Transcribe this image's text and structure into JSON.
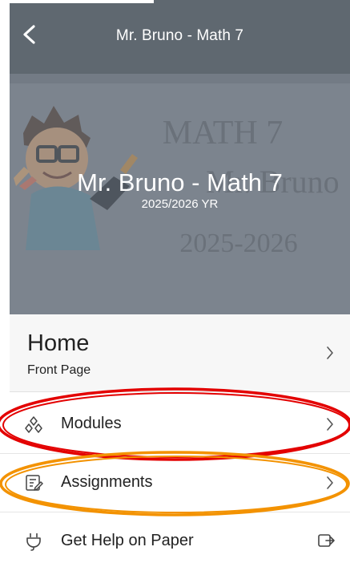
{
  "header": {
    "title": "Mr. Bruno - Math 7",
    "back_icon": "back-icon"
  },
  "hero": {
    "title": "Mr. Bruno - Math 7",
    "subtitle": "2025/2026 YR",
    "art_lines": [
      "MATH 7",
      "Mr. Bruno",
      "2025-2026"
    ]
  },
  "home": {
    "title": "Home",
    "subtitle": "Front Page"
  },
  "menu": {
    "items": [
      {
        "label": "Modules",
        "icon": "modules-icon"
      },
      {
        "label": "Assignments",
        "icon": "assignments-icon"
      },
      {
        "label": "Get Help on Paper",
        "icon": "plug-icon",
        "trailing_icon": "external-link-icon"
      }
    ]
  },
  "colors": {
    "header_bg": "#5f6870",
    "hero_bg": "#7b838d",
    "annotation_red": "#e30000",
    "annotation_orange": "#f39200"
  }
}
